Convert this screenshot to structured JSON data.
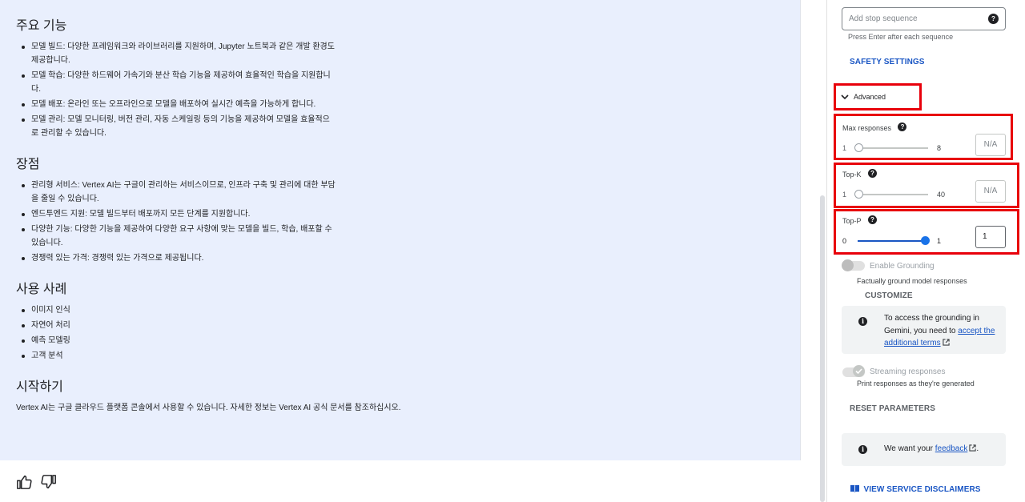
{
  "response": {
    "sections": [
      {
        "heading": "주요 기능",
        "items": [
          "모델 빌드: 다양한 프레임워크와 라이브러리를 지원하며, Jupyter 노트북과 같은 개발 환경도 제공합니다.",
          "모델 학습: 다양한 하드웨어 가속기와 분산 학습 기능을 제공하여 효율적인 학습을 지원합니다.",
          "모델 배포: 온라인 또는 오프라인으로 모델을 배포하여 실시간 예측을 가능하게 합니다.",
          "모델 관리: 모델 모니터링, 버전 관리, 자동 스케일링 등의 기능을 제공하여 모델을 효율적으로 관리할 수 있습니다."
        ]
      },
      {
        "heading": "장점",
        "items": [
          "관리형 서비스: Vertex AI는 구글이 관리하는 서비스이므로, 인프라 구축 및 관리에 대한 부담을 줄일 수 있습니다.",
          "엔드투엔드 지원: 모델 빌드부터 배포까지 모든 단계를 지원합니다.",
          "다양한 기능: 다양한 기능을 제공하여 다양한 요구 사항에 맞는 모델을 빌드, 학습, 배포할 수 있습니다.",
          "경쟁력 있는 가격: 경쟁력 있는 가격으로 제공됩니다."
        ]
      },
      {
        "heading": "사용 사례",
        "items": [
          "이미지 인식",
          "자연어 처리",
          "예측 모델링",
          "고객 분석"
        ]
      }
    ],
    "final_heading": "시작하기",
    "final_text": "Vertex AI는 구글 클라우드 플랫폼 콘솔에서 사용할 수 있습니다. 자세한 정보는 Vertex AI 공식 문서를 참조하십시오."
  },
  "feedback": {
    "thumbs_up_icon": "thumbs-up-icon",
    "thumbs_down_icon": "thumbs-down-icon"
  },
  "panel": {
    "stop_sequence": {
      "placeholder": "Add stop sequence",
      "hint": "Press Enter after each sequence"
    },
    "safety_settings": "SAFETY SETTINGS",
    "advanced": {
      "label": "Advanced",
      "expanded": true
    },
    "max_responses": {
      "label": "Max responses",
      "min": "1",
      "max": "8",
      "value": "N/A",
      "level": 0
    },
    "top_k": {
      "label": "Top-K",
      "min": "1",
      "max": "40",
      "value": "N/A",
      "level": 0
    },
    "top_p": {
      "label": "Top-P",
      "min": "0",
      "max": "1",
      "value": "1",
      "level": 1
    },
    "grounding": {
      "label": "Enable Grounding",
      "sub": "Factually ground model responses",
      "customize": "CUSTOMIZE",
      "enabled": false,
      "info_pre": "To access the grounding in Gemini, you need to",
      "info_link": "accept the additional terms"
    },
    "streaming": {
      "label": "Streaming responses",
      "sub": "Print responses as they're generated",
      "enabled": true
    },
    "reset": "RESET PARAMETERS",
    "feedback_card": {
      "pre": "We want your",
      "link": "feedback",
      "post": "."
    },
    "disclaimers": "VIEW SERVICE DISCLAIMERS"
  },
  "colors": {
    "accent": "#1a56c4",
    "highlight": "#e8000b",
    "response_bg": "#e9effd"
  }
}
